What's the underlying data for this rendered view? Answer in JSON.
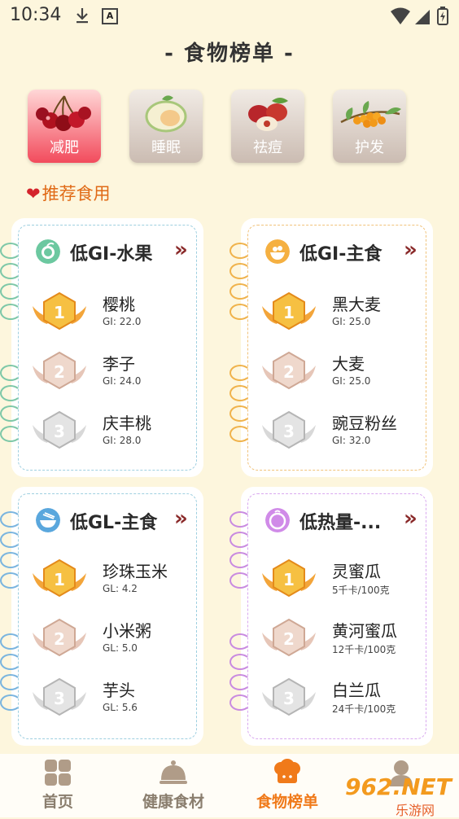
{
  "status_bar": {
    "time": "10:34"
  },
  "page_title": "- 食物榜单 -",
  "categories": [
    {
      "label": "减肥",
      "active": true
    },
    {
      "label": "睡眠",
      "active": false
    },
    {
      "label": "祛痘",
      "active": false
    },
    {
      "label": "护发",
      "active": false
    }
  ],
  "section_title": "推荐食用",
  "cards": [
    {
      "title": "低GI-水果",
      "items": [
        {
          "rank": "1",
          "name": "樱桃",
          "value": "GI: 22.0"
        },
        {
          "rank": "2",
          "name": "李子",
          "value": "GI: 24.0"
        },
        {
          "rank": "3",
          "name": "庆丰桃",
          "value": "GI: 28.0"
        }
      ]
    },
    {
      "title": "低GI-主食",
      "items": [
        {
          "rank": "1",
          "name": "黑大麦",
          "value": "GI: 25.0"
        },
        {
          "rank": "2",
          "name": "大麦",
          "value": "GI: 25.0"
        },
        {
          "rank": "3",
          "name": "豌豆粉丝",
          "value": "GI: 32.0"
        }
      ]
    },
    {
      "title": "低GL-主食",
      "items": [
        {
          "rank": "1",
          "name": "珍珠玉米",
          "value": "GL: 4.2"
        },
        {
          "rank": "2",
          "name": "小米粥",
          "value": "GL: 5.0"
        },
        {
          "rank": "3",
          "name": "芋头",
          "value": "GL: 5.6"
        }
      ]
    },
    {
      "title": "低热量-...",
      "items": [
        {
          "rank": "1",
          "name": "灵蜜瓜",
          "value": "5千卡/100克"
        },
        {
          "rank": "2",
          "name": "黄河蜜瓜",
          "value": "12千卡/100克"
        },
        {
          "rank": "3",
          "name": "白兰瓜",
          "value": "24千卡/100克"
        }
      ]
    }
  ],
  "more_glyph": "»",
  "tabbar": [
    {
      "label": "首页",
      "active": false
    },
    {
      "label": "健康食材",
      "active": false
    },
    {
      "label": "食物榜单",
      "active": true
    },
    {
      "label": "",
      "active": false
    }
  ],
  "watermark": {
    "line1": "962.NET",
    "line2": "乐游网"
  },
  "colors": {
    "accent_orange": "#f07a1a",
    "active_category": "#f24b5c",
    "recommend_text": "#e06a16",
    "background": "#fdf6dd"
  }
}
